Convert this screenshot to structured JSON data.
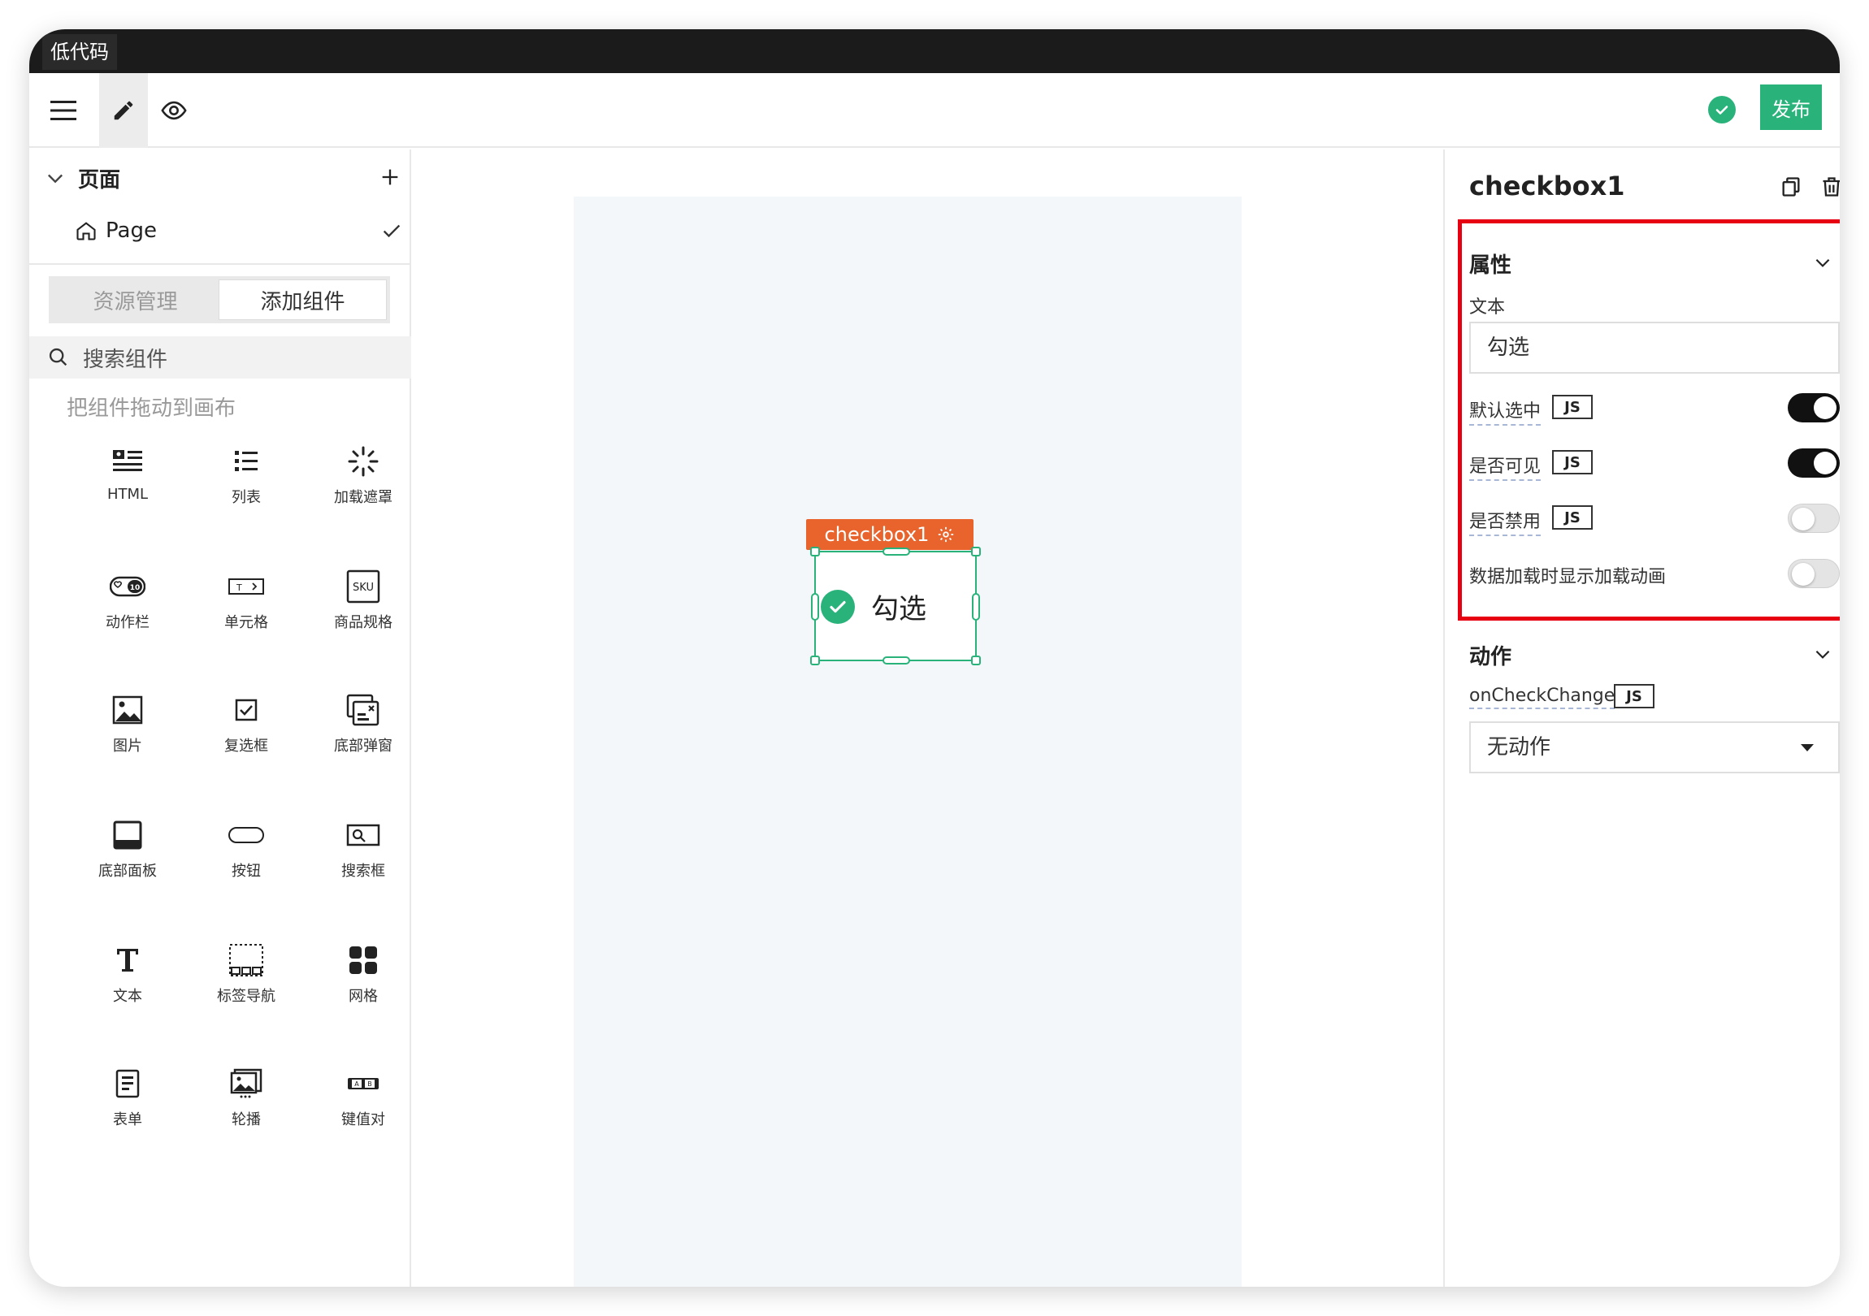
{
  "app": {
    "title": "低代码"
  },
  "toolbar": {
    "menu_icon": "hamburger-menu-icon",
    "edit_icon": "pencil-icon",
    "preview_icon": "eye-icon",
    "status_icon": "check-circle-icon",
    "publish_label": "发布"
  },
  "sidebar": {
    "pages_label": "页面",
    "add_page_icon": "plus-icon",
    "current_page": "Page",
    "tabs": [
      {
        "label": "资源管理",
        "active": false
      },
      {
        "label": "添加组件",
        "active": true
      }
    ],
    "search_placeholder": "搜索组件",
    "hint": "把组件拖动到画布",
    "components": [
      {
        "label": "HTML",
        "icon": "html-icon"
      },
      {
        "label": "列表",
        "icon": "list-icon"
      },
      {
        "label": "加载遮罩",
        "icon": "loading-spinner-icon"
      },
      {
        "label": "动作栏",
        "icon": "action-bar-icon"
      },
      {
        "label": "单元格",
        "icon": "cell-icon"
      },
      {
        "label": "商品规格",
        "icon": "sku-icon"
      },
      {
        "label": "图片",
        "icon": "image-icon"
      },
      {
        "label": "复选框",
        "icon": "checkbox-icon"
      },
      {
        "label": "底部弹窗",
        "icon": "bottom-popup-icon"
      },
      {
        "label": "底部面板",
        "icon": "bottom-panel-icon"
      },
      {
        "label": "按钮",
        "icon": "button-icon"
      },
      {
        "label": "搜索框",
        "icon": "search-box-icon"
      },
      {
        "label": "文本",
        "icon": "text-icon"
      },
      {
        "label": "标签导航",
        "icon": "tab-nav-icon"
      },
      {
        "label": "网格",
        "icon": "grid-icon"
      },
      {
        "label": "表单",
        "icon": "form-icon"
      },
      {
        "label": "轮播",
        "icon": "carousel-icon"
      },
      {
        "label": "键值对",
        "icon": "key-value-icon"
      }
    ]
  },
  "canvas": {
    "selected_tag": "checkbox1",
    "checkbox_label": "勾选"
  },
  "panel": {
    "title": "checkbox1",
    "properties_label": "属性",
    "text_label": "文本",
    "text_value": "勾选",
    "js_badge": "JS",
    "rows": [
      {
        "label": "默认选中",
        "js": true,
        "on": true
      },
      {
        "label": "是否可见",
        "js": true,
        "on": true
      },
      {
        "label": "是否禁用",
        "js": true,
        "on": false
      },
      {
        "label": "数据加载时显示加载动画",
        "js": false,
        "on": false
      }
    ],
    "actions_label": "动作",
    "event_label": "onCheckChange",
    "action_value": "无动作"
  },
  "colors": {
    "accent": "#2ab27b",
    "tag": "#e8642c",
    "highlight": "#e60012",
    "titlebar": "#1b1b1b"
  }
}
